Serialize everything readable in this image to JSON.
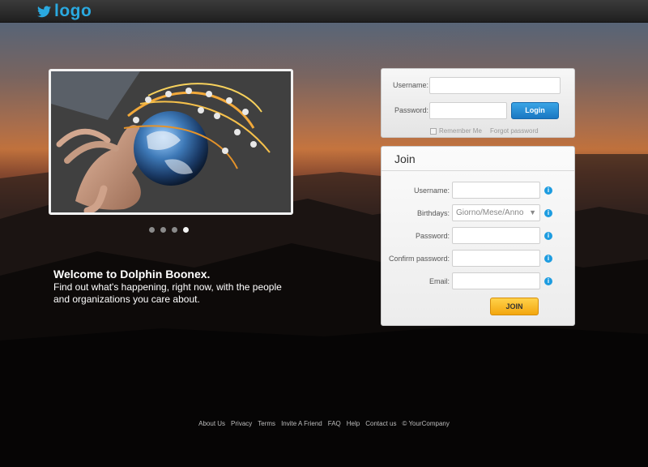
{
  "header": {
    "logo_text": "logo",
    "logo_icon": "bird-icon",
    "accent": "#2aa9e0"
  },
  "slider": {
    "dot_count": 4,
    "active_index": 3
  },
  "welcome": {
    "heading": "Welcome to Dolphin Boonex.",
    "text_line1": "Find out what's happening, right now, with the people",
    "text_line2": "and organizations you care about."
  },
  "login": {
    "username_label": "Username:",
    "password_label": "Password:",
    "username_value": "",
    "password_value": "",
    "login_button": "Login",
    "remember_label": "Remember Me",
    "forgot_link": "Forgot password"
  },
  "join": {
    "title": "Join",
    "username_label": "Username:",
    "birthdays_label": "Birthdays:",
    "birthdays_placeholder": "Giorno/Mese/Anno",
    "password_label": "Password:",
    "confirm_label": "Confirm password:",
    "email_label": "Email:",
    "join_button": "JOIN"
  },
  "footer": {
    "links": [
      "About Us",
      "Privacy",
      "Terms",
      "Invite A Friend",
      "FAQ",
      "Help",
      "Contact us",
      "© YourCompany"
    ]
  }
}
